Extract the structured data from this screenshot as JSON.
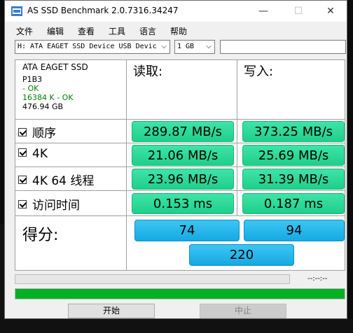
{
  "window": {
    "title": "AS SSD Benchmark 2.0.7316.34247",
    "controls": {
      "minimize": "—",
      "maximize": "☐",
      "close": "✕"
    }
  },
  "menu": [
    "文件",
    "编辑",
    "查看",
    "工具",
    "语言",
    "帮助"
  ],
  "toolbar": {
    "drive_select": "H: ATA EAGET SSD Device USB Devic",
    "size_select": "1 GB",
    "text_value": ""
  },
  "drive": {
    "name": "ATA EAGET SSD",
    "firmware": "P1B3",
    "status1": " - OK",
    "status2": "16384 K - OK",
    "capacity": "476.94 GB"
  },
  "columns": {
    "read": "读取:",
    "write": "写入:"
  },
  "rows": [
    {
      "label": "顺序",
      "read": "289.87 MB/s",
      "write": "373.25 MB/s",
      "checked": true
    },
    {
      "label": "4K",
      "read": "21.06 MB/s",
      "write": "25.69 MB/s",
      "checked": true
    },
    {
      "label": "4K 64 线程",
      "read": "23.96 MB/s",
      "write": "31.39 MB/s",
      "checked": true
    },
    {
      "label": "访问时间",
      "read": "0.153 ms",
      "write": "0.187 ms",
      "checked": true
    }
  ],
  "score": {
    "label": "得分:",
    "read": "74",
    "write": "94",
    "total": "220"
  },
  "status": {
    "time": "--:--:--",
    "progress_fraction": 1.0
  },
  "buttons": {
    "start": "开始",
    "stop": "中止"
  },
  "colors": {
    "result_green": "#2fdb9c",
    "score_blue": "#2ab8ee",
    "progress_green": "#06b025"
  }
}
